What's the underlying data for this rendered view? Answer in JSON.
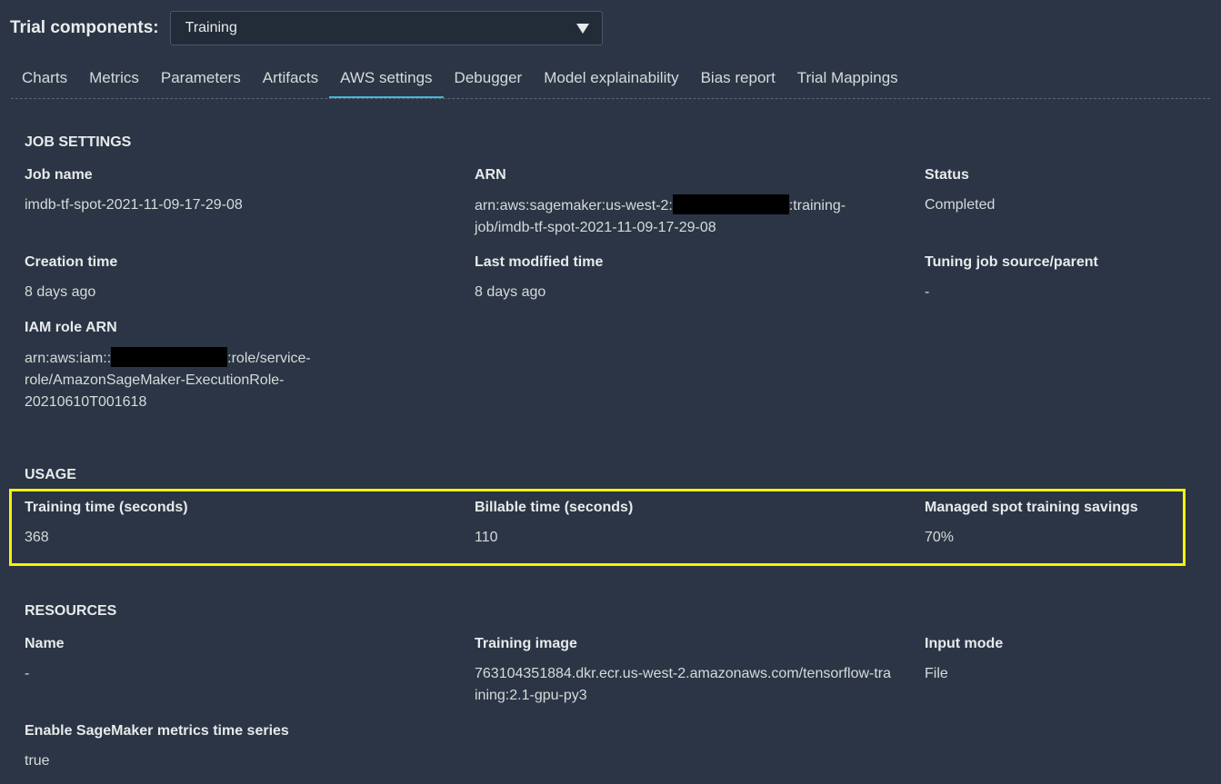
{
  "header": {
    "label": "Trial components:",
    "select_value": "Training"
  },
  "tabs": [
    {
      "label": "Charts"
    },
    {
      "label": "Metrics"
    },
    {
      "label": "Parameters"
    },
    {
      "label": "Artifacts"
    },
    {
      "label": "AWS settings",
      "active": true
    },
    {
      "label": "Debugger"
    },
    {
      "label": "Model explainability"
    },
    {
      "label": "Bias report"
    },
    {
      "label": "Trial Mappings"
    }
  ],
  "job_settings": {
    "heading": "JOB SETTINGS",
    "job_name": {
      "label": "Job name",
      "value": "imdb-tf-spot-2021-11-09-17-29-08"
    },
    "arn": {
      "label": "ARN",
      "value_prefix": "arn:aws:sagemaker:us-west-2:",
      "value_suffix": ":training-job/imdb-tf-spot-2021-11-09-17-29-08"
    },
    "status": {
      "label": "Status",
      "value": "Completed"
    },
    "creation_time": {
      "label": "Creation time",
      "value": "8 days ago"
    },
    "last_modified_time": {
      "label": "Last modified time",
      "value": "8 days ago"
    },
    "tuning_job_source": {
      "label": "Tuning job source/parent",
      "value": "-"
    },
    "iam_role_arn": {
      "label": "IAM role ARN",
      "value_prefix": "arn:aws:iam::",
      "value_suffix": ":role/service-role/AmazonSageMaker-ExecutionRole-20210610T001618"
    }
  },
  "usage": {
    "heading": "USAGE",
    "training_time": {
      "label": "Training time (seconds)",
      "value": "368"
    },
    "billable_time": {
      "label": "Billable time (seconds)",
      "value": "110"
    },
    "spot_savings": {
      "label": "Managed spot training savings",
      "value": "70%"
    }
  },
  "resources": {
    "heading": "RESOURCES",
    "name": {
      "label": "Name",
      "value": "-"
    },
    "training_image": {
      "label": "Training image",
      "value": "763104351884.dkr.ecr.us-west-2.amazonaws.com/tensorflow-training:2.1-gpu-py3"
    },
    "input_mode": {
      "label": "Input mode",
      "value": "File"
    },
    "metrics_time_series": {
      "label": "Enable SageMaker metrics time series",
      "value": "true"
    }
  },
  "colors": {
    "background": "#2b3545",
    "accent_tab_underline": "#44b9d6",
    "highlight_box": "#f5f20a",
    "redaction": "#000000"
  }
}
